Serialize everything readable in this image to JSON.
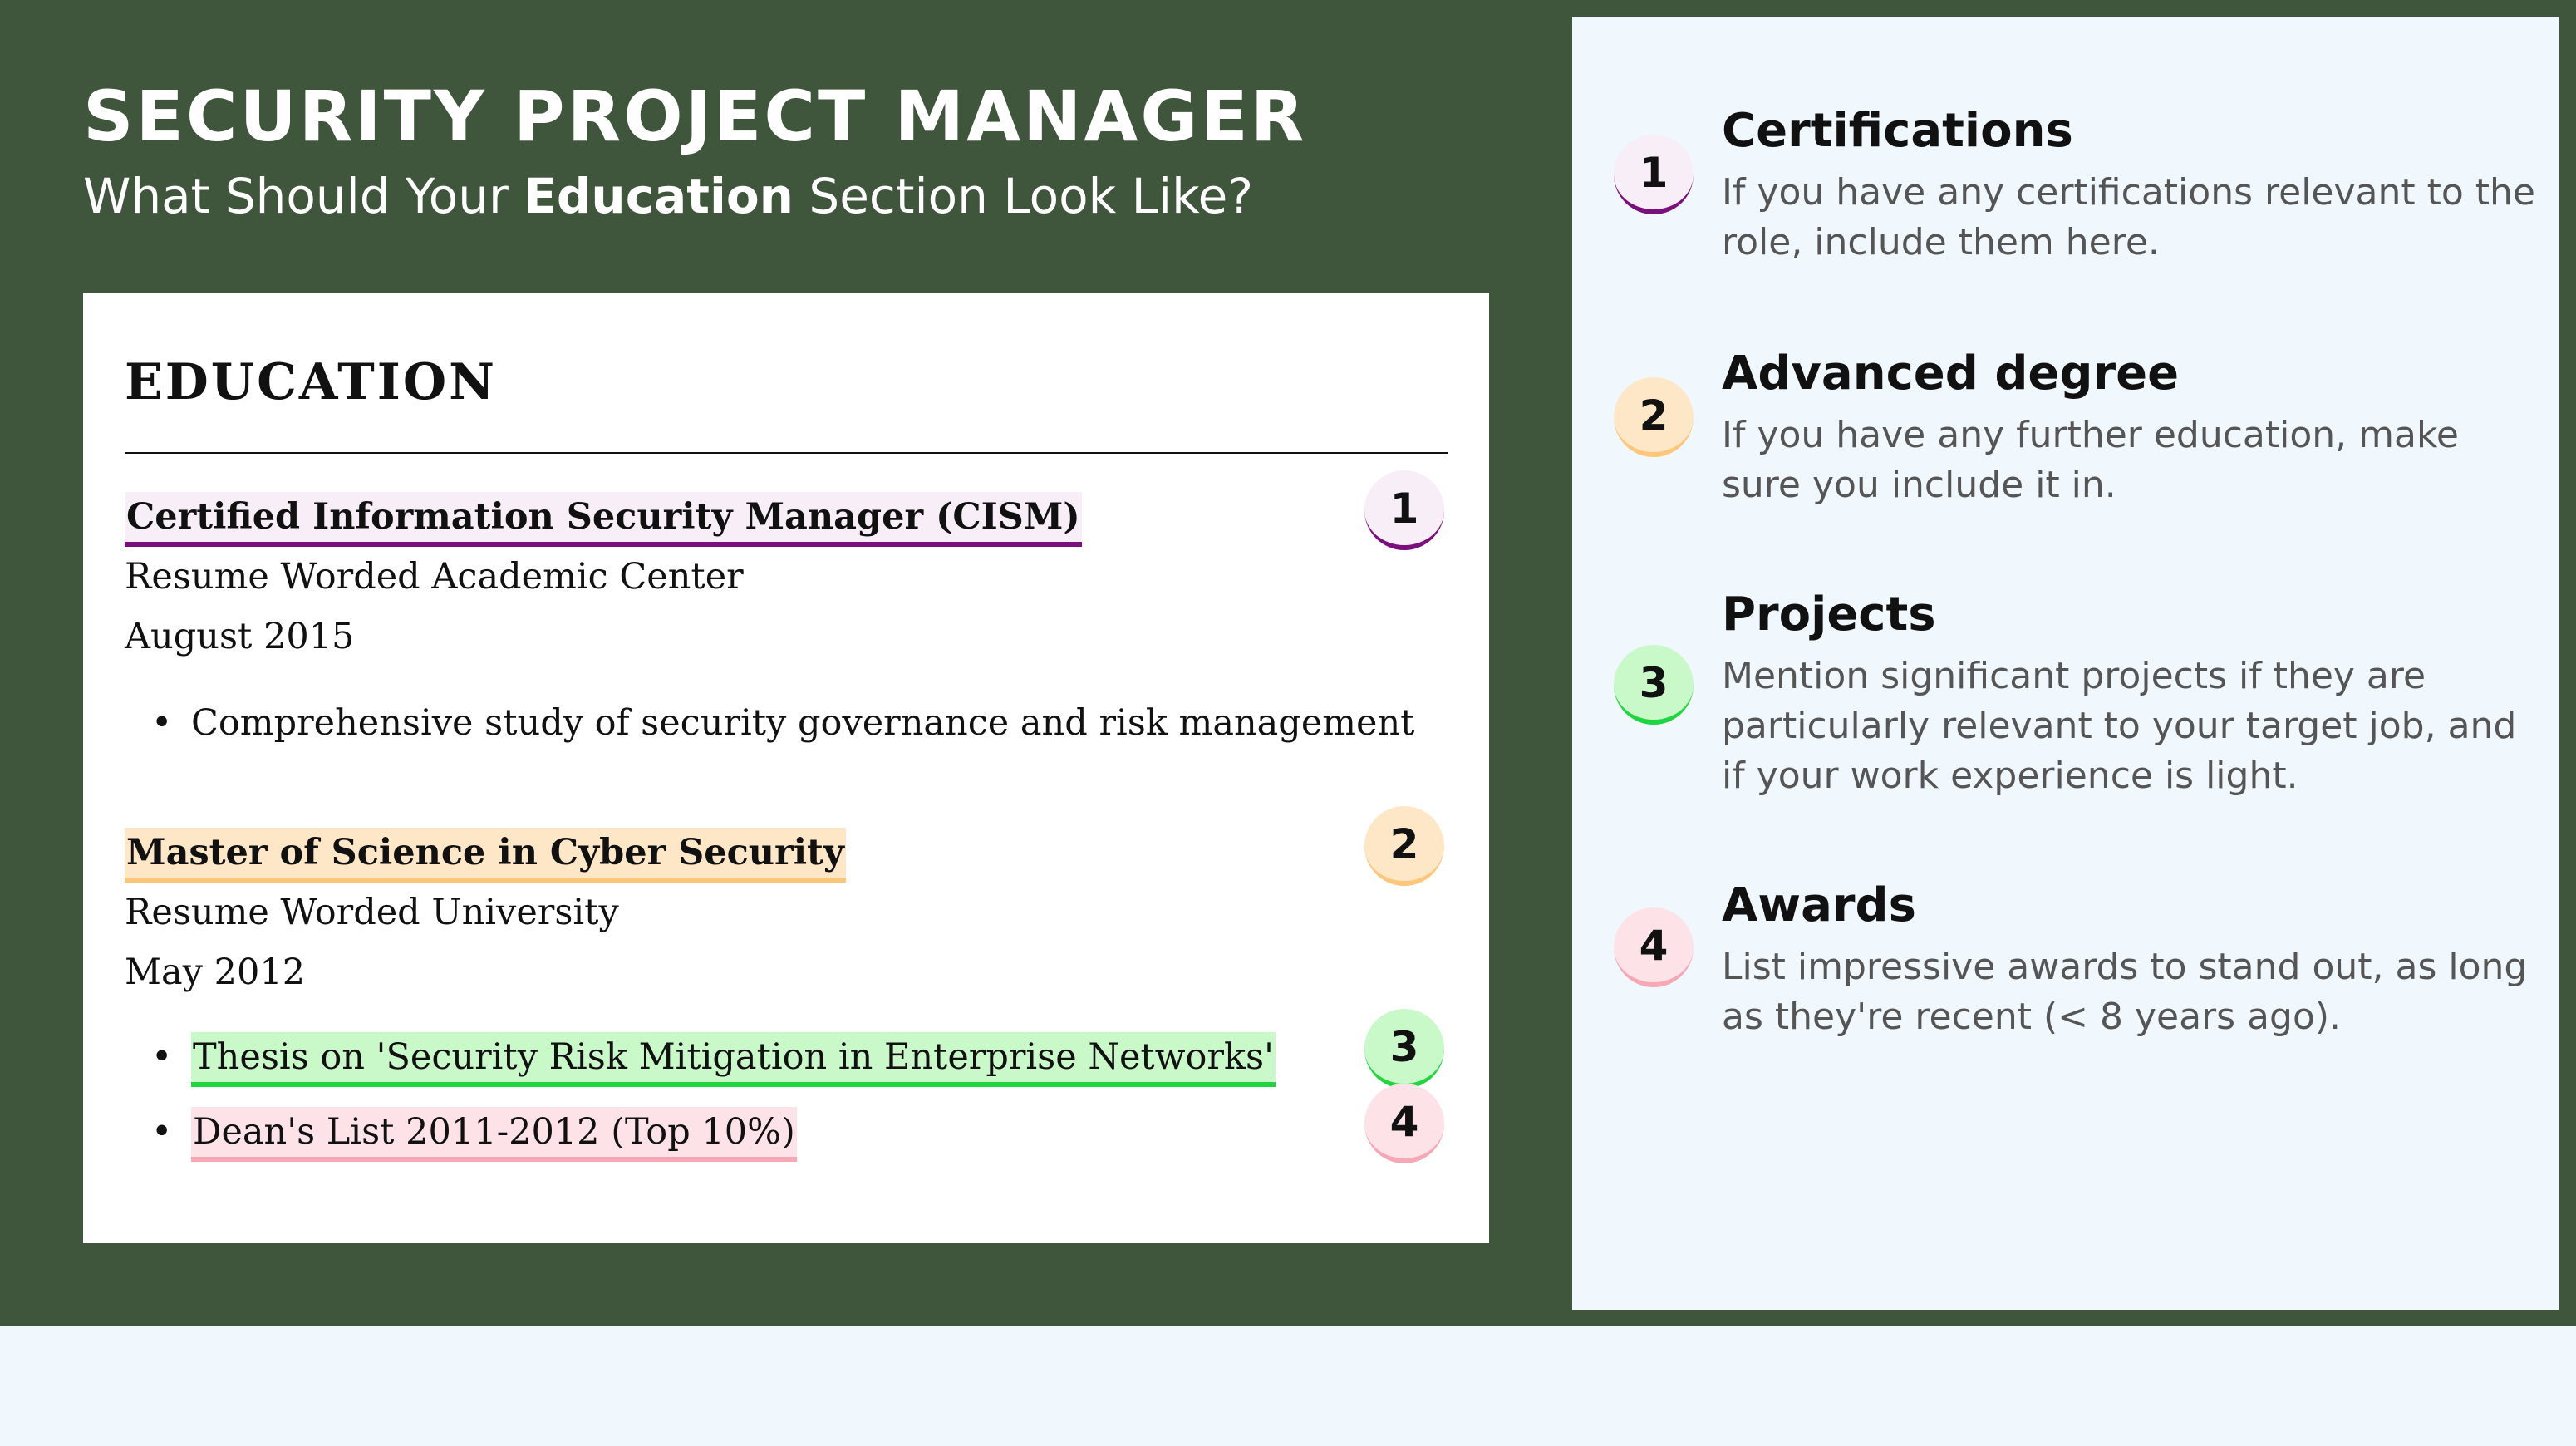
{
  "header": {
    "title": "SECURITY PROJECT MANAGER",
    "subtitle_before": "What Should Your ",
    "subtitle_bold": "Education",
    "subtitle_after": " Section Look Like?"
  },
  "resume": {
    "heading": "EDUCATION",
    "entries": [
      {
        "title": "Certified Information Security Manager (CISM)",
        "institution": "Resume Worded Academic Center",
        "date": "August 2015",
        "bullets": [
          "Comprehensive study of security governance and risk management"
        ]
      },
      {
        "title": "Master of Science in Cyber Security",
        "institution": "Resume Worded University",
        "date": "May 2012",
        "bullets": [
          "Thesis on 'Security Risk Mitigation in Enterprise Networks'",
          "Dean's List 2011-2012 (Top 10%)"
        ]
      }
    ],
    "bullet_symbol": "•",
    "badges": [
      "1",
      "2",
      "3",
      "4"
    ]
  },
  "tips": [
    {
      "number": "1",
      "title": "Certifications",
      "body": "If you have any certifications relevant to the role, include them here."
    },
    {
      "number": "2",
      "title": "Advanced degree",
      "body": "If you have any further education, make sure you include it in."
    },
    {
      "number": "3",
      "title": "Projects",
      "body": "Mention significant projects if they are particularly relevant to your target job, and if your work experience is light."
    },
    {
      "number": "4",
      "title": "Awards",
      "body": "List impressive awards to stand out, as long as they're recent (< 8 years ago)."
    }
  ],
  "colors": {
    "background_dark_green": "#40563c",
    "panel_light_blue": "#f0f7fd",
    "highlight_1_fill": "#f7eef8",
    "highlight_1_underline": "#7b0f7b",
    "highlight_2_fill": "#fde7c7",
    "highlight_2_underline": "#fcc77b",
    "highlight_3_fill": "#c9f8c9",
    "highlight_3_underline": "#1fd63e",
    "highlight_4_fill": "#fde3e7",
    "highlight_4_underline": "#f6a8b5"
  }
}
